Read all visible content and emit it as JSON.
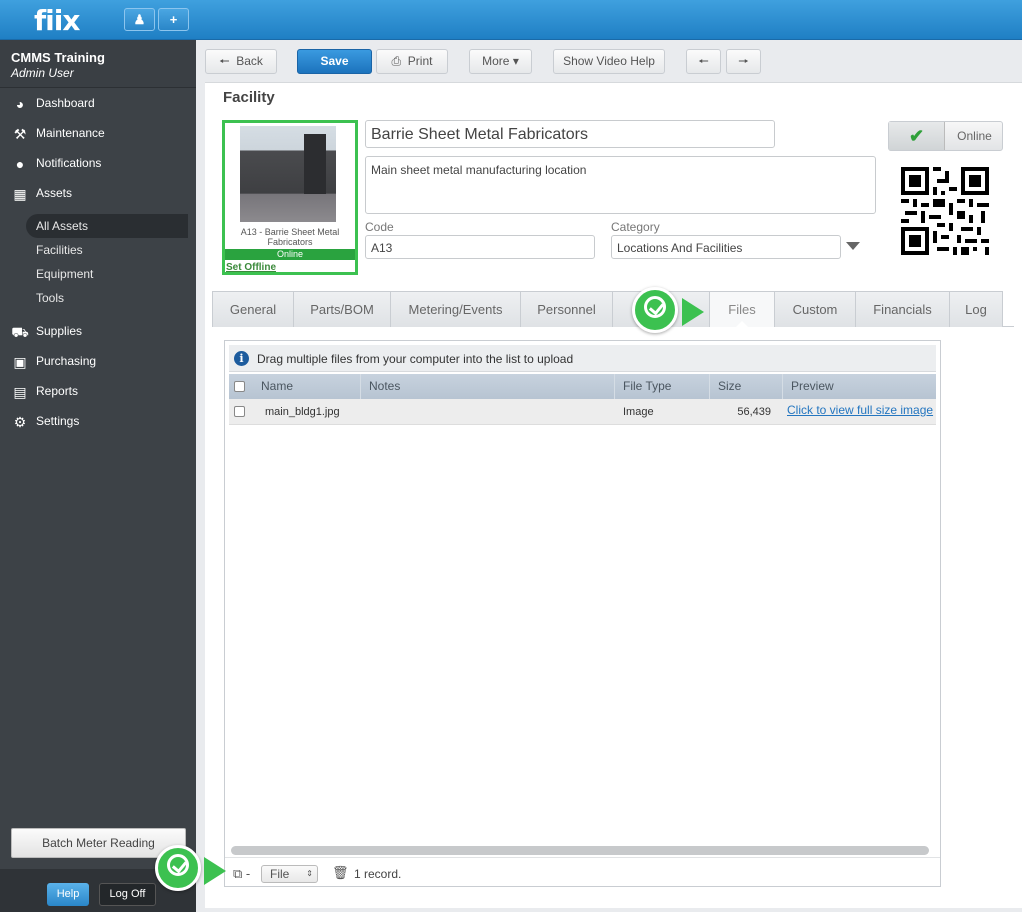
{
  "app": {
    "logo": "fiix",
    "user_icon": "user-icon",
    "add_icon": "plus-icon",
    "add_label": "+"
  },
  "sidebar": {
    "org": "CMMS Training",
    "user": "Admin User",
    "items": [
      {
        "label": "Dashboard",
        "icon": "dashboard-icon"
      },
      {
        "label": "Maintenance",
        "icon": "tools-icon"
      },
      {
        "label": "Notifications",
        "icon": "chat-icon"
      },
      {
        "label": "Assets",
        "icon": "boxes-icon"
      },
      {
        "label": "Supplies",
        "icon": "truck-icon"
      },
      {
        "label": "Purchasing",
        "icon": "cart-icon"
      },
      {
        "label": "Reports",
        "icon": "chart-icon"
      },
      {
        "label": "Settings",
        "icon": "gear-icon"
      }
    ],
    "asset_subitems": [
      "All Assets",
      "Facilities",
      "Equipment",
      "Tools"
    ],
    "batch_button": "Batch Meter Reading",
    "help_button": "Help",
    "logoff_button": "Log Off"
  },
  "toolbar": {
    "back": "Back",
    "save": "Save",
    "print": "Print",
    "more": "More",
    "video_help": "Show Video Help"
  },
  "record": {
    "type_title": "Facility",
    "name": "Barrie Sheet Metal Fabricators",
    "description": "Main sheet metal manufacturing location",
    "code_label": "Code",
    "code": "A13",
    "category_label": "Category",
    "category": "Locations And Facilities",
    "photo_caption": "A13 - Barrie Sheet Metal Fabricators",
    "photo_status": "Online",
    "set_offline": "Set Offline",
    "status": "Online"
  },
  "tabs": [
    "General",
    "Parts/BOM",
    "Metering/Events",
    "Personnel",
    "",
    "Files",
    "Custom",
    "Financials",
    "Log"
  ],
  "active_tab": "Files",
  "files": {
    "drag_hint": "Drag multiple files from your computer into the list to upload",
    "columns": [
      "Name",
      "Notes",
      "File Type",
      "Size",
      "Preview"
    ],
    "rows": [
      {
        "name": "main_bldg1.jpg",
        "notes": "",
        "type": "Image",
        "size": "56,439",
        "preview": "Click to view full size image"
      }
    ],
    "file_select": "File",
    "record_count": "1 record."
  },
  "colors": {
    "accent": "#1f7fc4",
    "marker": "#3cc150",
    "online": "#2aa33f"
  }
}
